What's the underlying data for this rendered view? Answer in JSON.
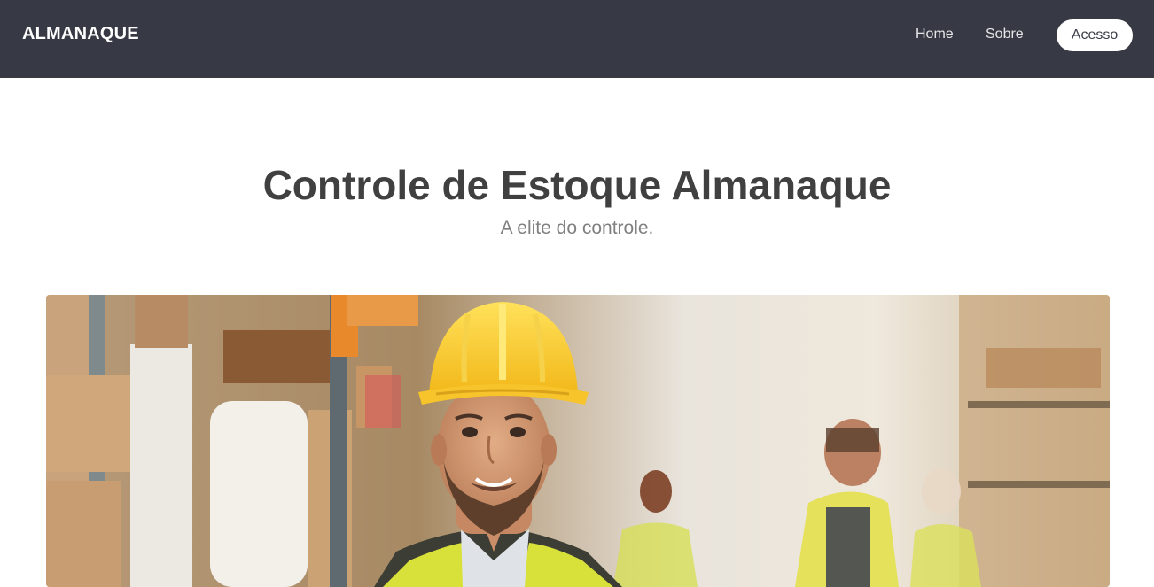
{
  "navbar": {
    "brand": "ALMANAQUE",
    "links": [
      {
        "label": "Home"
      },
      {
        "label": "Sobre"
      }
    ],
    "access_button": "Acesso",
    "background_color": "#373a44"
  },
  "hero": {
    "title": "Controle de Estoque Almanaque",
    "subtitle": "A elite do controle."
  },
  "banner": {
    "alt": "Warehouse worker wearing a yellow hard hat and safety vest"
  }
}
